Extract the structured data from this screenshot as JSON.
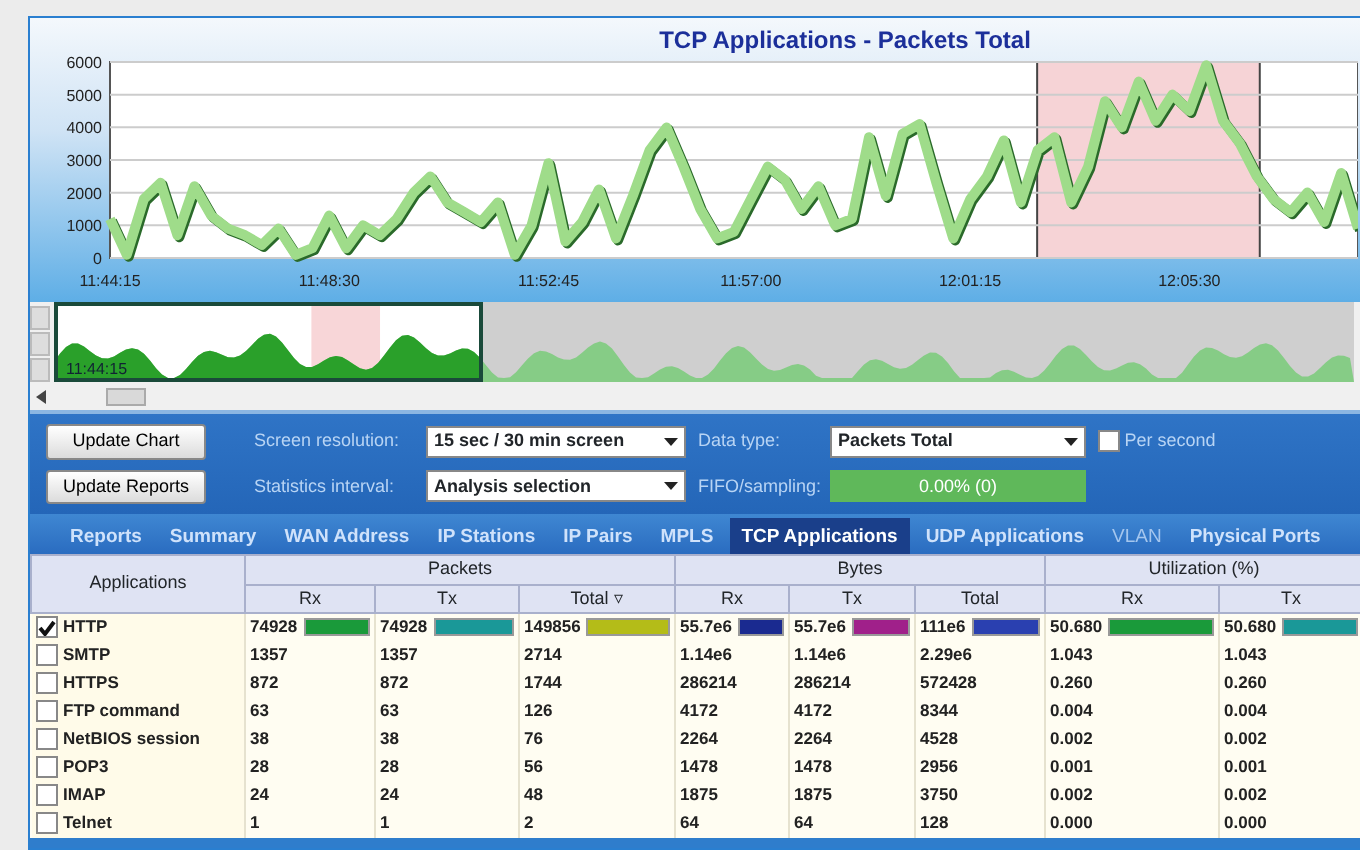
{
  "chart": {
    "chart_data": {
      "type": "line",
      "title": "TCP Applications - Packets Total",
      "categories": [
        "11:44:15",
        null,
        null,
        null,
        null,
        null,
        null,
        null,
        null,
        null,
        null,
        null,
        null,
        "11:48:30",
        null,
        null,
        null,
        null,
        null,
        null,
        null,
        null,
        null,
        null,
        null,
        null,
        "11:52:45",
        null,
        null,
        null,
        null,
        null,
        null,
        null,
        null,
        null,
        null,
        null,
        "11:57:00",
        null,
        null,
        null,
        null,
        null,
        null,
        null,
        null,
        null,
        null,
        null,
        null,
        "12:01:15",
        null,
        null,
        null,
        null,
        null,
        null,
        null,
        null,
        null,
        null,
        null,
        null,
        "12:05:30",
        null,
        null,
        null,
        null,
        null,
        null,
        null,
        null,
        null,
        null
      ],
      "series": [
        {
          "color": "#9fdc8a",
          "values": [
            1200,
            100,
            1800,
            2300,
            700,
            2200,
            1300,
            900,
            700,
            400,
            900,
            100,
            300,
            1300,
            300,
            1000,
            700,
            1200,
            2000,
            2500,
            1700,
            1400,
            1100,
            1700,
            100,
            1000,
            2900,
            500,
            1100,
            2100,
            600,
            1900,
            3300,
            4000,
            2800,
            1500,
            600,
            800,
            1800,
            2800,
            2400,
            1500,
            2200,
            1000,
            1200,
            3700,
            1900,
            3800,
            4100,
            2300,
            600,
            1800,
            2500,
            3600,
            1700,
            3300,
            3700,
            1700,
            2800,
            4800,
            4000,
            5400,
            4200,
            5000,
            4500,
            5900,
            4200,
            3500,
            2500,
            1800,
            1400,
            2000,
            1100,
            2600,
            900
          ]
        }
      ],
      "ylim": [
        0,
        6000
      ],
      "grid": true,
      "yticks": [
        0,
        1000,
        2000,
        3000,
        4000,
        5000,
        6000
      ]
    }
  },
  "overview": {
    "label": "11:44:15",
    "level": 0.33
  },
  "controls": {
    "update_chart": "Update Chart",
    "update_reports": "Update Reports",
    "screen_resolution": {
      "label": "Screen resolution:",
      "value": "15 sec / 30 min screen"
    },
    "statistics_interval": {
      "label": "Statistics interval:",
      "value": "Analysis selection"
    },
    "data_type": {
      "label": "Data type:",
      "value": "Packets Total"
    },
    "per_second": {
      "label": "Per second",
      "checked": false
    },
    "fifo": {
      "label": "FIFO/sampling:",
      "value": "0.00% (0)"
    }
  },
  "tabs": [
    {
      "label": "Reports",
      "selected": false,
      "disabled": false
    },
    {
      "label": "Summary",
      "selected": false,
      "disabled": false
    },
    {
      "label": "WAN Address",
      "selected": false,
      "disabled": false
    },
    {
      "label": "IP Stations",
      "selected": false,
      "disabled": false
    },
    {
      "label": "IP Pairs",
      "selected": false,
      "disabled": false
    },
    {
      "label": "MPLS",
      "selected": false,
      "disabled": false
    },
    {
      "label": "TCP Applications",
      "selected": true,
      "disabled": false
    },
    {
      "label": "UDP Applications",
      "selected": false,
      "disabled": false
    },
    {
      "label": "VLAN",
      "selected": false,
      "disabled": true
    },
    {
      "label": "Physical Ports",
      "selected": false,
      "disabled": false
    }
  ],
  "table": {
    "first_column": "Applications",
    "groups": [
      {
        "label": "Packets",
        "columns": [
          {
            "label": "Rx",
            "color": "#1a9a3a"
          },
          {
            "label": "Tx",
            "color": "#1a9898"
          },
          {
            "label": "Total ▿",
            "color": "#b4bc18"
          }
        ]
      },
      {
        "label": "Bytes",
        "columns": [
          {
            "label": "Rx",
            "color": "#1a2a90"
          },
          {
            "label": "Tx",
            "color": "#a0208a"
          },
          {
            "label": "Total",
            "color": "#2a40b0"
          }
        ]
      },
      {
        "label": "Utilization (%)",
        "columns": [
          {
            "label": "Rx",
            "color": "#1a9a3a"
          },
          {
            "label": "Tx",
            "color": "#1a9898"
          }
        ]
      }
    ],
    "rows": [
      {
        "name": "HTTP",
        "checked": true,
        "cells": [
          {
            "text": "74928",
            "level": 1
          },
          {
            "text": "74928",
            "level": 1
          },
          {
            "text": "149856",
            "level": 1
          },
          {
            "text": "55.7e6",
            "level": 1
          },
          {
            "text": "55.7e6",
            "level": 1
          },
          {
            "text": "111e6",
            "level": 1
          },
          {
            "text": "50.680",
            "level": 1
          },
          {
            "text": "50.680",
            "level": 1
          }
        ]
      },
      {
        "name": "SMTP",
        "checked": false,
        "cells": [
          "1357",
          "1357",
          "2714",
          "1.14e6",
          "1.14e6",
          "2.29e6",
          "1.043",
          "1.043"
        ]
      },
      {
        "name": "HTTPS",
        "checked": false,
        "cells": [
          "872",
          "872",
          "1744",
          "286214",
          "286214",
          "572428",
          "0.260",
          "0.260"
        ]
      },
      {
        "name": "FTP command",
        "checked": false,
        "cells": [
          "63",
          "63",
          "126",
          "4172",
          "4172",
          "8344",
          "0.004",
          "0.004"
        ]
      },
      {
        "name": "NetBIOS session",
        "checked": false,
        "cells": [
          "38",
          "38",
          "76",
          "2264",
          "2264",
          "4528",
          "0.002",
          "0.002"
        ]
      },
      {
        "name": "POP3",
        "checked": false,
        "cells": [
          "28",
          "28",
          "56",
          "1478",
          "1478",
          "2956",
          "0.001",
          "0.001"
        ]
      },
      {
        "name": "IMAP",
        "checked": false,
        "cells": [
          "24",
          "24",
          "48",
          "1875",
          "1875",
          "3750",
          "0.002",
          "0.002"
        ]
      },
      {
        "name": "Telnet",
        "checked": false,
        "cells": [
          "1",
          "1",
          "2",
          "64",
          "64",
          "128",
          "0.000",
          "0.000"
        ]
      }
    ]
  }
}
